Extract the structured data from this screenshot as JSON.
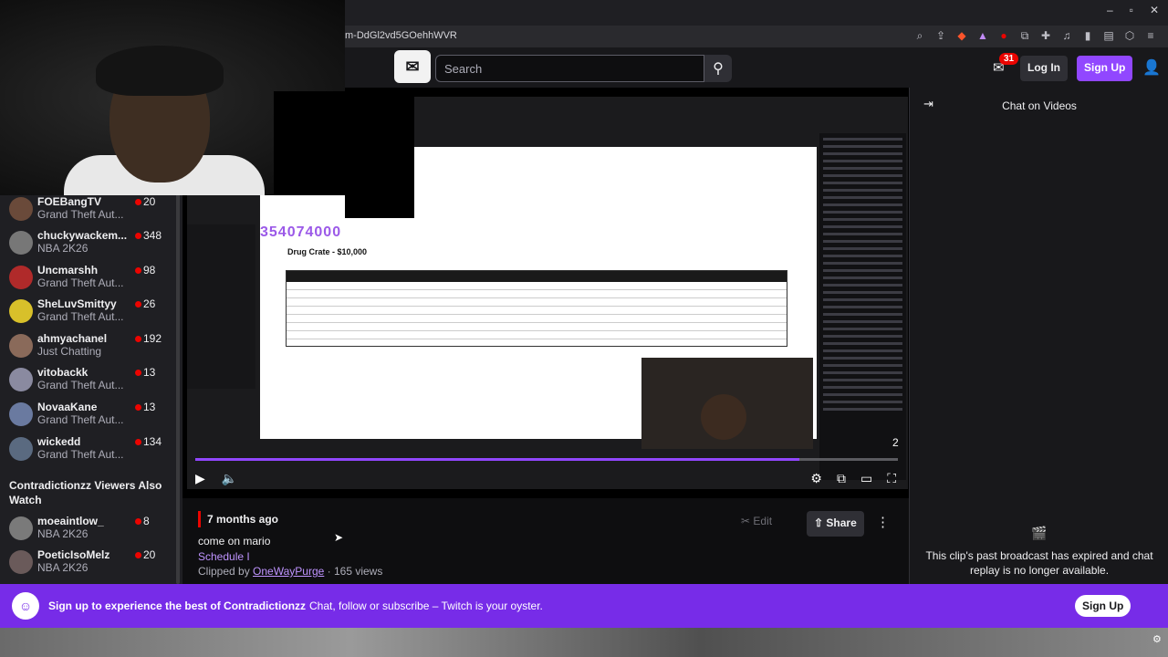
{
  "browser": {
    "url": "m-DdGl2vd5GOehhWVR"
  },
  "nav": {
    "search_placeholder": "Search",
    "notification_count": "31",
    "login_label": "Log In",
    "signup_label": "Sign Up"
  },
  "sidebar": {
    "channels": [
      {
        "name": "FOEBangTV",
        "game": "Grand Theft Aut...",
        "viewers": "20"
      },
      {
        "name": "chuckywackem...",
        "game": "NBA 2K26",
        "viewers": "348"
      },
      {
        "name": "Uncmarshh",
        "game": "Grand Theft Aut...",
        "viewers": "98"
      },
      {
        "name": "SheLuvSmittyy",
        "game": "Grand Theft Aut...",
        "viewers": "26"
      },
      {
        "name": "ahmyachanel",
        "game": "Just Chatting",
        "viewers": "192"
      },
      {
        "name": "vitobackk",
        "game": "Grand Theft Aut...",
        "viewers": "13"
      },
      {
        "name": "NovaaKane",
        "game": "Grand Theft Aut...",
        "viewers": "13"
      },
      {
        "name": "wickedd",
        "game": "Grand Theft Aut...",
        "viewers": "134"
      }
    ],
    "also_watch_heading": "Contradictionzz Viewers Also Watch",
    "also_watch": [
      {
        "name": "moeaintlow_",
        "game": "NBA 2K26",
        "viewers": "8"
      },
      {
        "name": "PoeticIsoMelz",
        "game": "NBA 2K26",
        "viewers": "20"
      }
    ]
  },
  "player": {
    "embedded_number": "354074000",
    "embedded_title": "Drug Crate - $10,000",
    "overlay_number": "2",
    "progress": 0.86
  },
  "clip": {
    "time_ago": "7 months ago",
    "title": "come on mario",
    "game": "Schedule I",
    "clipped_by_prefix": "Clipped by",
    "clipper": "OneWayPurge",
    "views": "· 165 views",
    "edit_label": "Edit",
    "share_label": "Share"
  },
  "chat": {
    "title": "Chat on Videos",
    "message": "This clip's past broadcast has expired and chat replay is no longer available."
  },
  "banner": {
    "bold_text": "Sign up to experience the best of Contradictionzz",
    "text": "Chat, follow or subscribe – Twitch is your oyster.",
    "button": "Sign Up"
  },
  "colors": {
    "accent": "#9147ff",
    "banner": "#772ce8",
    "live": "#eb0400"
  }
}
